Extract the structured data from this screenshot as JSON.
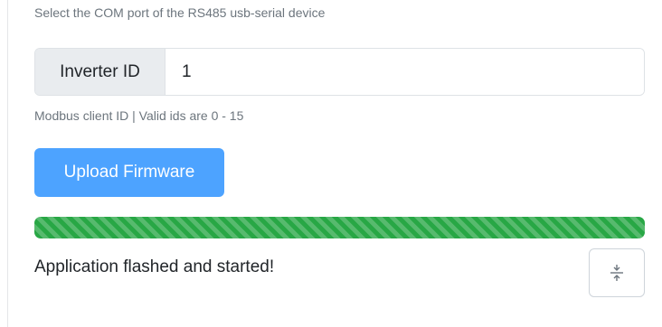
{
  "com_port": {
    "help_text": "Select the COM port of the RS485 usb-serial device"
  },
  "inverter": {
    "label": "Inverter ID",
    "value": "1",
    "help_text": "Modbus client ID | Valid ids are 0 - 15"
  },
  "upload_button": {
    "label": "Upload Firmware"
  },
  "progress": {
    "percent": 100,
    "color": "#28a745"
  },
  "status": {
    "message": "Application flashed and started!"
  },
  "icons": {
    "toggle": "expand-collapse-icon"
  },
  "colors": {
    "primary": "#4da3ff",
    "success": "#28a745",
    "muted": "#6c757d"
  }
}
